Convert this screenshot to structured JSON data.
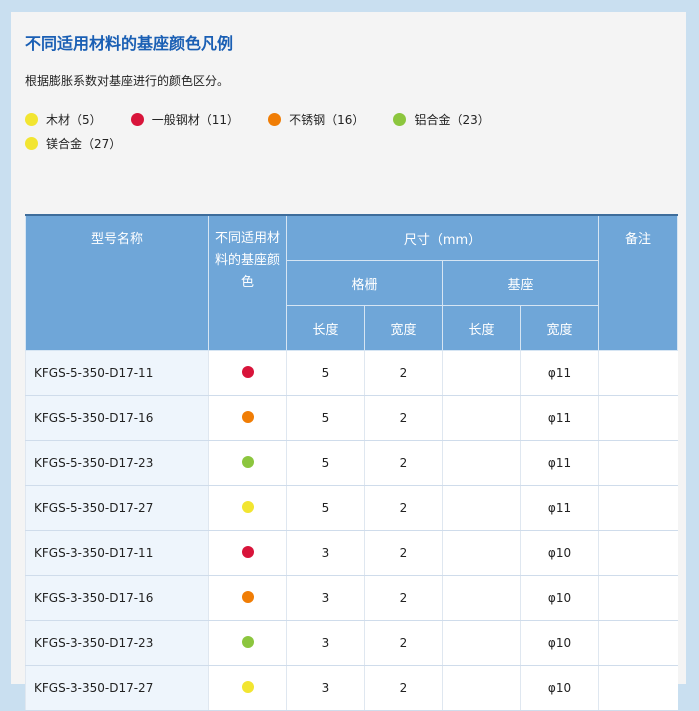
{
  "title": "不同适用材料的基座颜色凡例",
  "subtitle": "根据膨胀系数对基座进行的颜色区分。",
  "legend": [
    {
      "label": "木材（5）",
      "color": "#f2e531"
    },
    {
      "label": "一般钢材（11）",
      "color": "#d8143a"
    },
    {
      "label": "不锈钢（16）",
      "color": "#f07d05"
    },
    {
      "label": "铝合金（23）",
      "color": "#8cc63e"
    },
    {
      "label": "镁合金（27）",
      "color": "#f2e531"
    }
  ],
  "table": {
    "headers": {
      "model": "型号名称",
      "color": "不同适用材料的基座颜色",
      "size": "尺寸（mm）",
      "note": "备注",
      "grating": "格栅",
      "base": "基座",
      "length1": "长度",
      "width1": "宽度",
      "length2": "长度",
      "width2": "宽度"
    },
    "rows": [
      {
        "model": "KFGS-5-350-D17-11",
        "color": "#d8143a",
        "gl": "5",
        "gw": "2",
        "bl": "",
        "bw": "φ11",
        "note": ""
      },
      {
        "model": "KFGS-5-350-D17-16",
        "color": "#f07d05",
        "gl": "5",
        "gw": "2",
        "bl": "",
        "bw": "φ11",
        "note": ""
      },
      {
        "model": "KFGS-5-350-D17-23",
        "color": "#8cc63e",
        "gl": "5",
        "gw": "2",
        "bl": "",
        "bw": "φ11",
        "note": ""
      },
      {
        "model": "KFGS-5-350-D17-27",
        "color": "#f2e531",
        "gl": "5",
        "gw": "2",
        "bl": "",
        "bw": "φ11",
        "note": ""
      },
      {
        "model": "KFGS-3-350-D17-11",
        "color": "#d8143a",
        "gl": "3",
        "gw": "2",
        "bl": "",
        "bw": "φ10",
        "note": ""
      },
      {
        "model": "KFGS-3-350-D17-16",
        "color": "#f07d05",
        "gl": "3",
        "gw": "2",
        "bl": "",
        "bw": "φ10",
        "note": ""
      },
      {
        "model": "KFGS-3-350-D17-23",
        "color": "#8cc63e",
        "gl": "3",
        "gw": "2",
        "bl": "",
        "bw": "φ10",
        "note": ""
      },
      {
        "model": "KFGS-3-350-D17-27",
        "color": "#f2e531",
        "gl": "3",
        "gw": "2",
        "bl": "",
        "bw": "φ10",
        "note": ""
      }
    ]
  }
}
